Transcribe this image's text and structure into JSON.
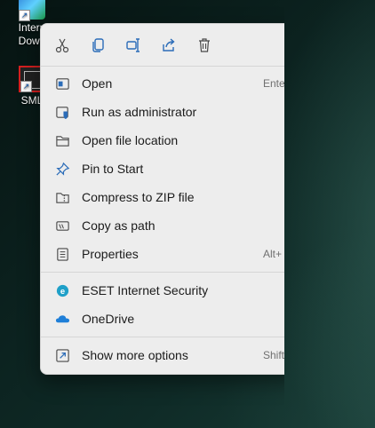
{
  "desktop": {
    "icons": [
      {
        "label_line1": "Intern",
        "label_line2": "Down"
      },
      {
        "label_line1": "SML",
        "label_line2": ""
      }
    ]
  },
  "context_menu": {
    "quick_actions": [
      {
        "name": "Cut",
        "icon": "scissors-icon"
      },
      {
        "name": "Copy",
        "icon": "copy-icon"
      },
      {
        "name": "Rename",
        "icon": "rename-icon"
      },
      {
        "name": "Share",
        "icon": "share-icon"
      },
      {
        "name": "Delete",
        "icon": "trash-icon"
      }
    ],
    "items": [
      {
        "label": "Open",
        "accelerator": "Ente",
        "icon": "open-window-icon"
      },
      {
        "label": "Run as administrator",
        "accelerator": "",
        "icon": "shield-window-icon"
      },
      {
        "label": "Open file location",
        "accelerator": "",
        "icon": "folder-icon"
      },
      {
        "label": "Pin to Start",
        "accelerator": "",
        "icon": "pin-icon"
      },
      {
        "label": "Compress to ZIP file",
        "accelerator": "",
        "icon": "zip-folder-icon"
      },
      {
        "label": "Copy as path",
        "accelerator": "",
        "icon": "copy-path-icon"
      },
      {
        "label": "Properties",
        "accelerator": "Alt+",
        "icon": "properties-icon"
      },
      {
        "label": "ESET Internet Security",
        "accelerator": "",
        "icon": "eset-icon"
      },
      {
        "label": "OneDrive",
        "accelerator": "",
        "icon": "onedrive-icon"
      },
      {
        "label": "Show more options",
        "accelerator": "Shift",
        "icon": "more-options-icon"
      }
    ],
    "colors": {
      "accent": "#2b6cb8",
      "background": "#ededed",
      "eset": "#1fa0c8",
      "onedrive": "#1f7fd8"
    }
  }
}
